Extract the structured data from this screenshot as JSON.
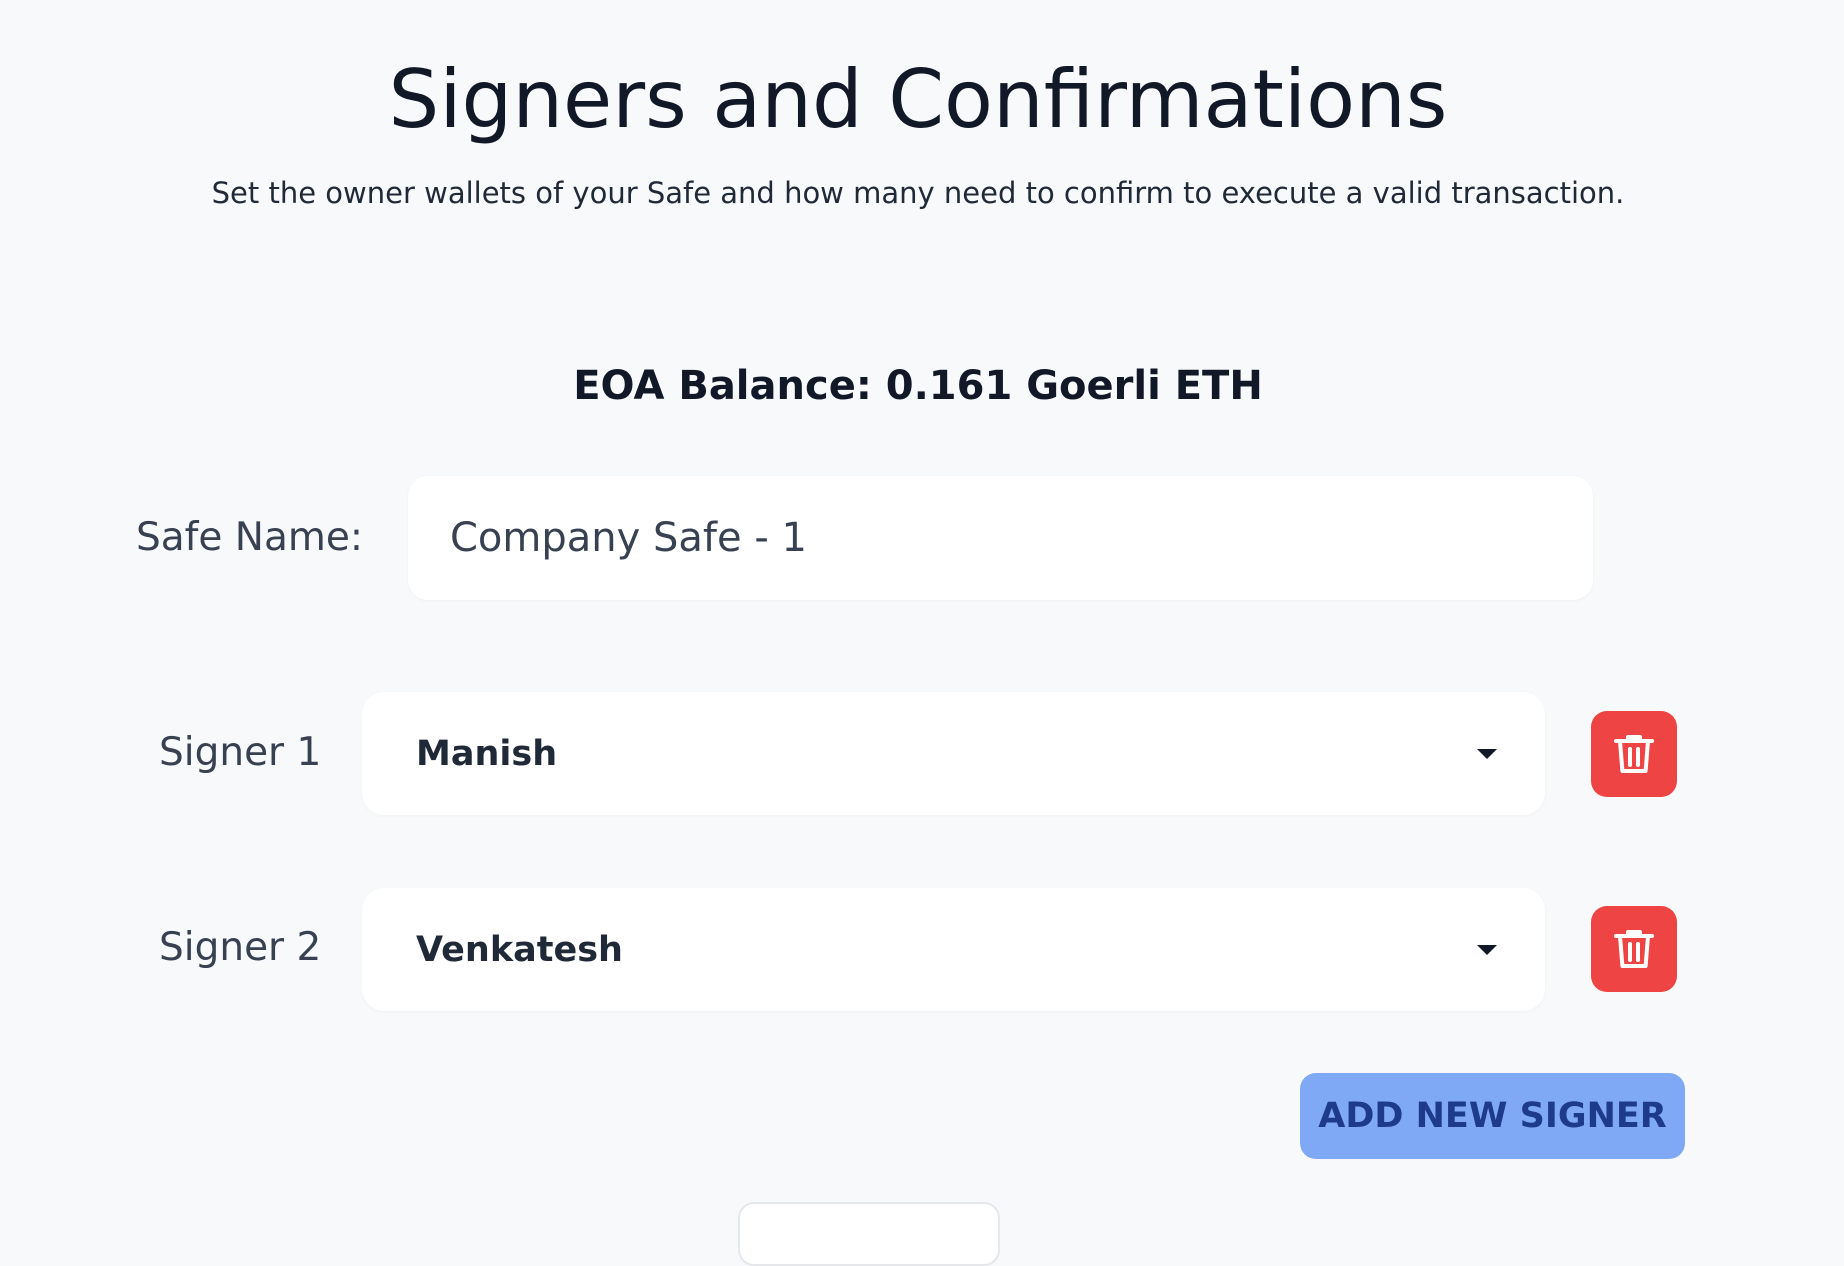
{
  "header": {
    "title": "Signers and Confirmations",
    "subtitle": "Set the owner wallets of your Safe and how many need to confirm to execute a valid transaction."
  },
  "balance": {
    "text": "EOA Balance: 0.161 Goerli ETH"
  },
  "safe_name": {
    "label": "Safe Name:",
    "value": "Company Safe - 1"
  },
  "signers": [
    {
      "label": "Signer 1",
      "value": "Manish"
    },
    {
      "label": "Signer 2",
      "value": "Venkatesh"
    }
  ],
  "actions": {
    "add_signer_label": "ADD NEW SIGNER"
  },
  "colors": {
    "background": "#f8f9fb",
    "delete": "#ef4444",
    "add_button": "#7fa8f5",
    "add_button_text": "#1e3a8a"
  },
  "icons": {
    "delete": "trash-icon",
    "dropdown": "chevron-down-icon"
  }
}
